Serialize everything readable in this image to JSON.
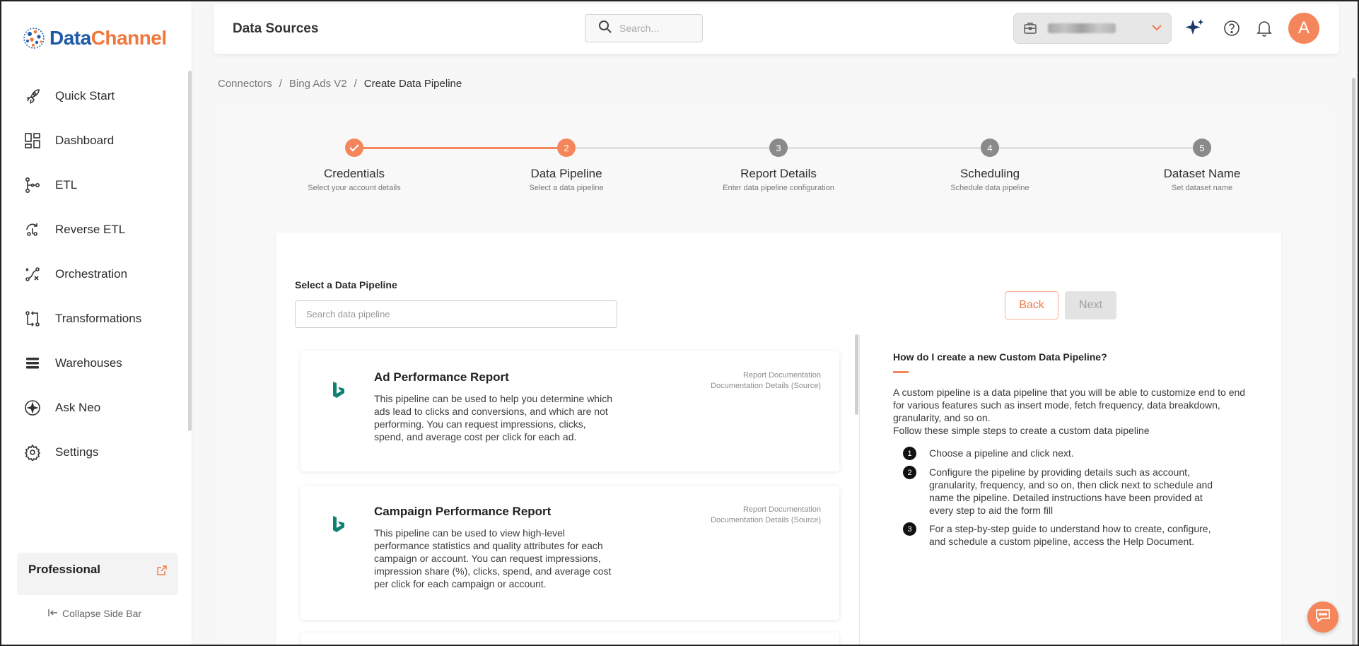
{
  "brand": {
    "part1": "Data",
    "part2": "Channel"
  },
  "sidebar": {
    "items": [
      {
        "label": "Quick Start",
        "icon": "rocket-icon"
      },
      {
        "label": "Dashboard",
        "icon": "dashboard-icon"
      },
      {
        "label": "ETL",
        "icon": "etl-icon"
      },
      {
        "label": "Reverse ETL",
        "icon": "reverse-etl-icon"
      },
      {
        "label": "Orchestration",
        "icon": "orchestration-icon"
      },
      {
        "label": "Transformations",
        "icon": "transformations-icon"
      },
      {
        "label": "Warehouses",
        "icon": "warehouses-icon"
      },
      {
        "label": "Ask Neo",
        "icon": "ask-neo-icon"
      },
      {
        "label": "Settings",
        "icon": "gear-icon"
      }
    ],
    "plan": "Professional",
    "collapse": "Collapse Side Bar"
  },
  "header": {
    "title": "Data Sources",
    "search_placeholder": "Search...",
    "avatar_letter": "A"
  },
  "breadcrumb": {
    "c1": "Connectors",
    "sep": "/",
    "c2": "Bing Ads V2",
    "c3": "Create Data Pipeline"
  },
  "stepper": [
    {
      "num": "1",
      "name": "Credentials",
      "desc": "Select your account details",
      "state": "done"
    },
    {
      "num": "2",
      "name": "Data Pipeline",
      "desc": "Select a data pipeline",
      "state": "active"
    },
    {
      "num": "3",
      "name": "Report Details",
      "desc": "Enter data pipeline configuration",
      "state": "pending"
    },
    {
      "num": "4",
      "name": "Scheduling",
      "desc": "Schedule data pipeline",
      "state": "pending"
    },
    {
      "num": "5",
      "name": "Dataset Name",
      "desc": "Set dataset name",
      "state": "pending"
    }
  ],
  "pipeline": {
    "select_label": "Select a Data Pipeline",
    "search_placeholder": "Search data pipeline",
    "back": "Back",
    "next": "Next",
    "cards": [
      {
        "title": "Ad Performance Report",
        "desc": "This pipeline can be used to help you determine which ads lead to clicks and conversions, and which are not performing. You can request impressions, clicks, spend, and average cost per click for each ad.",
        "link1": "Report Documentation",
        "link2": "Documentation Details (Source)"
      },
      {
        "title": "Campaign Performance Report",
        "desc": "This pipeline can be used to view high-level performance statistics and quality attributes for each campaign or account. You can request impressions, impression share (%), clicks, spend, and average cost per click for each campaign or account.",
        "link1": "Report Documentation",
        "link2": "Documentation Details (Source)"
      }
    ]
  },
  "help": {
    "title": "How do I create a new Custom Data Pipeline?",
    "intro": "A custom pipeline is a data pipeline that you will be able to customize end to end for various features such as insert mode, fetch frequency, data breakdown, granularity, and so on.",
    "intro2": "Follow these simple steps to create a custom data pipeline",
    "steps": [
      {
        "num": "1",
        "text": "Choose a pipeline and click next."
      },
      {
        "num": "2",
        "text": "Configure the pipeline by providing details such as account, granularity, frequency, and so on, then click next to schedule and name the pipeline. Detailed instructions have been provided at every step to aid the form fill"
      },
      {
        "num": "3",
        "text": "For a step-by-step guide to understand how to create, configure, and schedule a custom pipeline, access the Help Document."
      }
    ]
  },
  "colors": {
    "accent": "#f5855a",
    "brand_blue": "#1e5aa8"
  }
}
